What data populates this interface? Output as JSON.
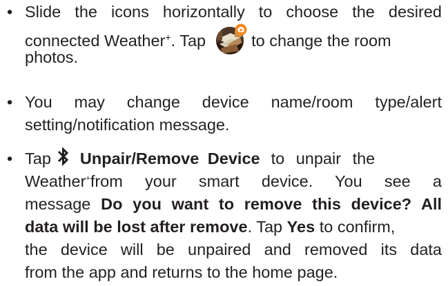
{
  "bullets": [
    {
      "line1": "Slide the icons horizontally to choose the desired",
      "line2_pre": "connected Weather",
      "line2_sup": "+",
      "line2_tap": ". Tap",
      "line2_post": "to change the room",
      "line3": "photos.",
      "icon": "room-photo-camera-icon"
    },
    {
      "line1": "You may change device name/room type/alert",
      "line2": "setting/notification message."
    },
    {
      "line1_tap": "Tap",
      "line1_bold": "Unpair/Remove Device",
      "line1_post": "to unpair the",
      "line2_pre": "Weather",
      "line2_sup": "+",
      "line2_post": "from your smart device. You see a",
      "line3_pre": "message",
      "line3_bold": "Do you want to remove this device? All",
      "line4_bold": "data will be lost after remove",
      "line4_mid": ". Tap",
      "line4_bold2": "Yes",
      "line4_post": "to confirm,",
      "line5": "the device will be unpaired and removed its data",
      "line6": "from the app and returns to the home page.",
      "icon": "bluetooth-icon"
    }
  ],
  "bullet_char": "•",
  "colors": {
    "text": "#231f20",
    "camera_badge": "#f08a24"
  }
}
